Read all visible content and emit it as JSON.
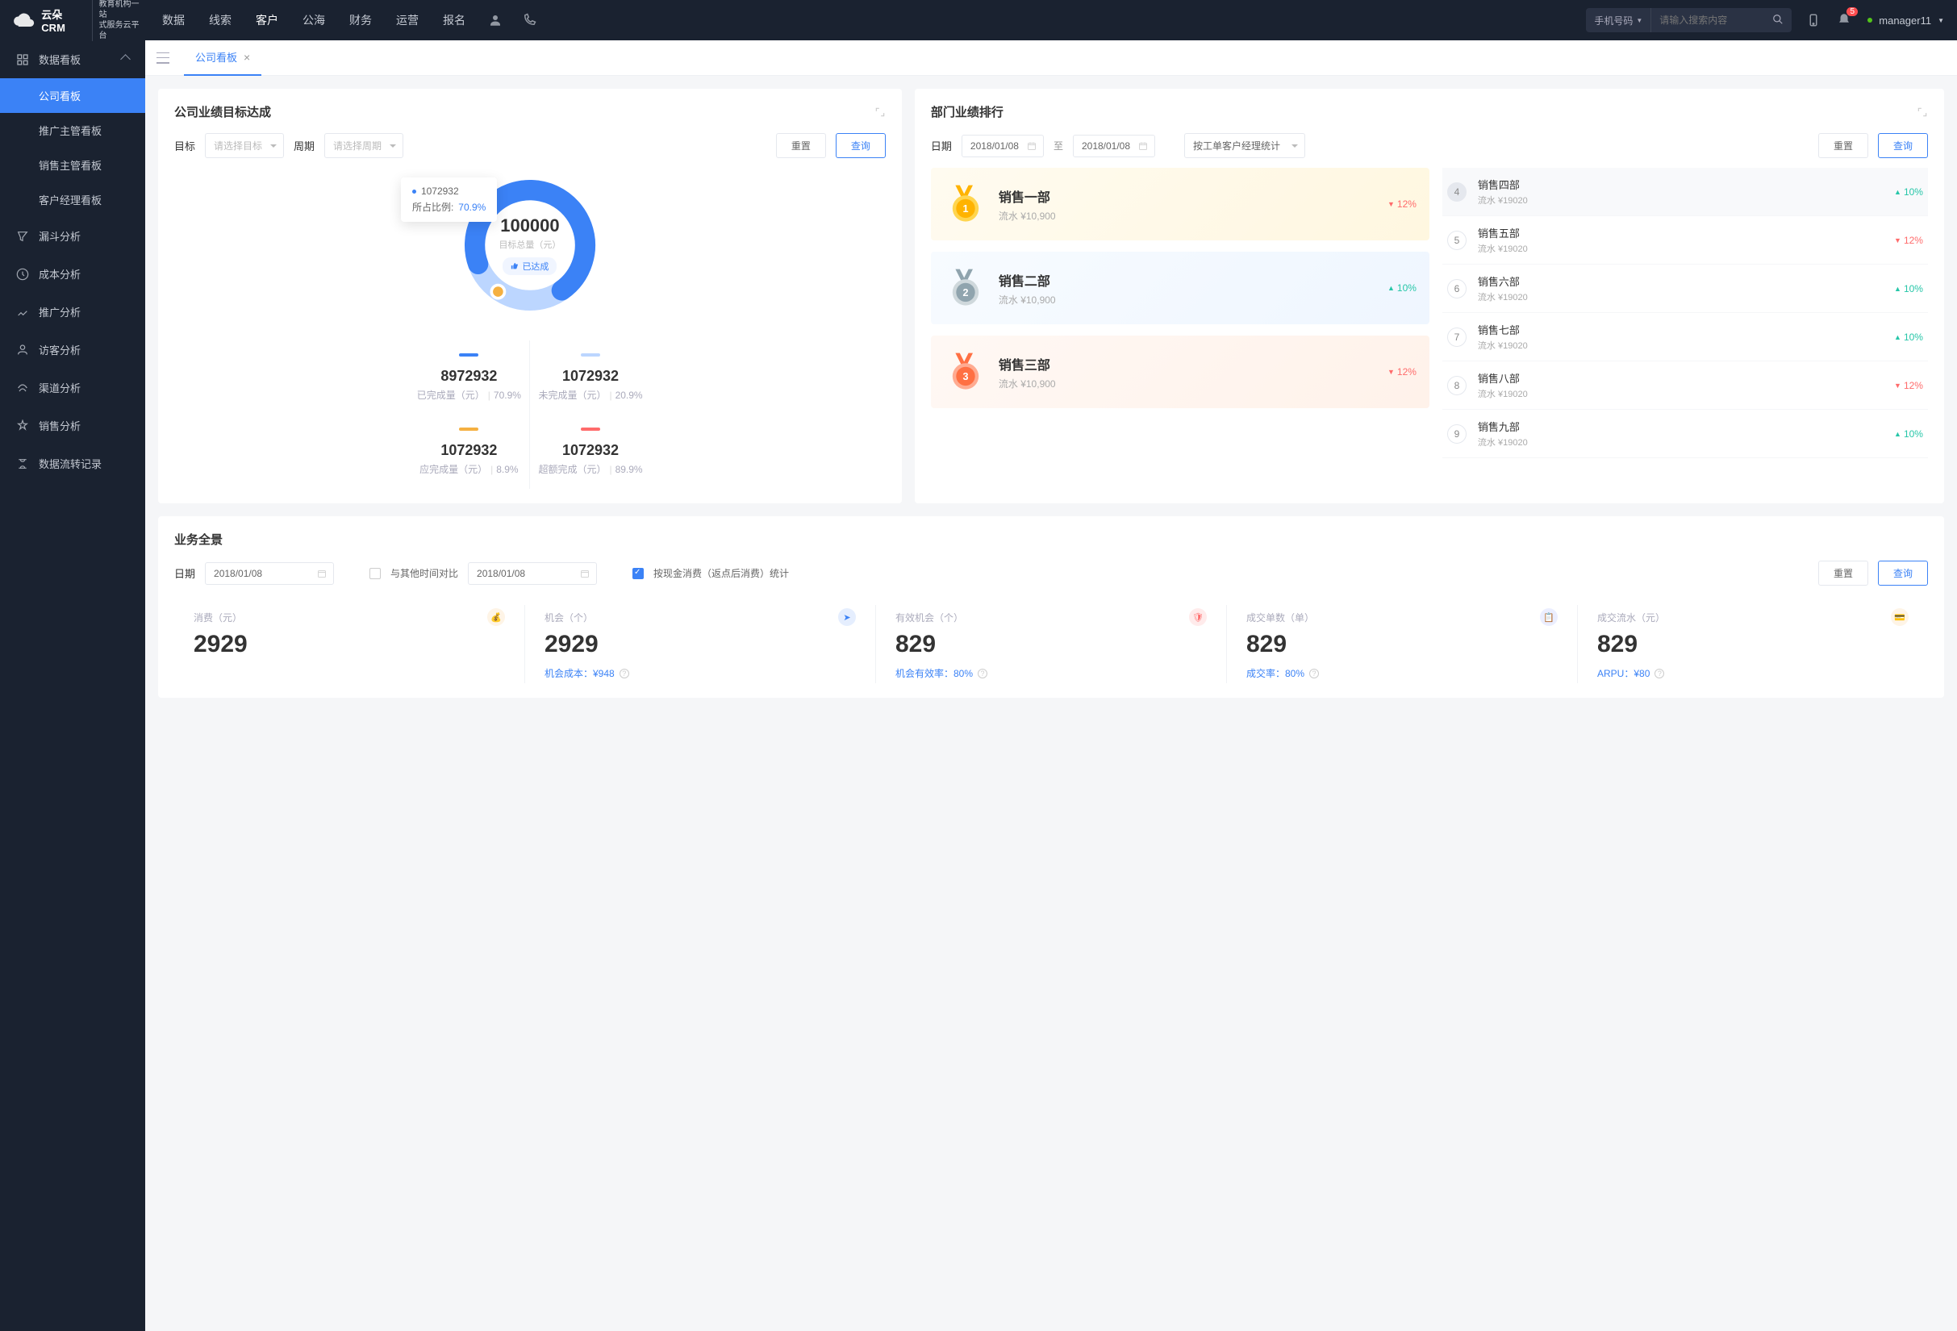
{
  "logo": {
    "brand": "云朵CRM",
    "sub1": "教育机构一站",
    "sub2": "式服务云平台"
  },
  "topnav": {
    "items": [
      "数据",
      "线索",
      "客户",
      "公海",
      "财务",
      "运营",
      "报名"
    ],
    "activeIndex": 2
  },
  "search": {
    "type": "手机号码",
    "placeholder": "请输入搜索内容"
  },
  "notification_count": "5",
  "user": "manager11",
  "sidebar": {
    "group_title": "数据看板",
    "subs": [
      "公司看板",
      "推广主管看板",
      "销售主管看板",
      "客户经理看板"
    ],
    "items": [
      "漏斗分析",
      "成本分析",
      "推广分析",
      "访客分析",
      "渠道分析",
      "销售分析",
      "数据流转记录"
    ]
  },
  "tab": {
    "label": "公司看板"
  },
  "goal_card": {
    "title": "公司业绩目标达成",
    "filters": {
      "target_label": "目标",
      "target_ph": "请选择目标",
      "period_label": "周期",
      "period_ph": "请选择周期"
    },
    "reset": "重置",
    "query": "查询",
    "tooltip": {
      "value": "1072932",
      "ratio_label": "所占比例:",
      "ratio": "70.9%"
    },
    "center": {
      "value": "100000",
      "label": "目标总量（元）",
      "status": "已达成"
    },
    "stats": [
      {
        "bar": "#3b82f6",
        "value": "8972932",
        "label": "已完成量（元）",
        "pct": "70.9%"
      },
      {
        "bar": "#bcd6ff",
        "value": "1072932",
        "label": "未完成量（元）",
        "pct": "20.9%"
      },
      {
        "bar": "#f5b041",
        "value": "1072932",
        "label": "应完成量（元）",
        "pct": "8.9%"
      },
      {
        "bar": "#ff6b6b",
        "value": "1072932",
        "label": "超额完成（元）",
        "pct": "89.9%"
      }
    ]
  },
  "rank_card": {
    "title": "部门业绩排行",
    "filters": {
      "date_label": "日期",
      "date_from": "2018/01/08",
      "date_to_label": "至",
      "date_to": "2018/01/08",
      "stat_by": "按工单客户经理统计"
    },
    "reset": "重置",
    "query": "查询",
    "top3": [
      {
        "name": "销售一部",
        "sub": "流水 ¥10,900",
        "pct": "12%",
        "dir": "up"
      },
      {
        "name": "销售二部",
        "sub": "流水 ¥10,900",
        "pct": "10%",
        "dir": "down"
      },
      {
        "name": "销售三部",
        "sub": "流水 ¥10,900",
        "pct": "12%",
        "dir": "up"
      }
    ],
    "rest": [
      {
        "n": "4",
        "name": "销售四部",
        "sub": "流水 ¥19020",
        "pct": "10%",
        "dir": "down"
      },
      {
        "n": "5",
        "name": "销售五部",
        "sub": "流水 ¥19020",
        "pct": "12%",
        "dir": "up"
      },
      {
        "n": "6",
        "name": "销售六部",
        "sub": "流水 ¥19020",
        "pct": "10%",
        "dir": "down"
      },
      {
        "n": "7",
        "name": "销售七部",
        "sub": "流水 ¥19020",
        "pct": "10%",
        "dir": "down"
      },
      {
        "n": "8",
        "name": "销售八部",
        "sub": "流水 ¥19020",
        "pct": "12%",
        "dir": "up"
      },
      {
        "n": "9",
        "name": "销售九部",
        "sub": "流水 ¥19020",
        "pct": "10%",
        "dir": "down"
      }
    ]
  },
  "overview": {
    "title": "业务全景",
    "date_label": "日期",
    "date1": "2018/01/08",
    "compare_label": "与其他时间对比",
    "date2": "2018/01/08",
    "cash_label": "按现金消费（返点后消费）统计",
    "reset": "重置",
    "query": "查询",
    "kpis": [
      {
        "label": "消费（元）",
        "value": "2929",
        "sub": "",
        "color": "#f5b041"
      },
      {
        "label": "机会（个）",
        "value": "2929",
        "sub_label": "机会成本：",
        "sub_val": "¥948",
        "color": "#3b82f6"
      },
      {
        "label": "有效机会（个）",
        "value": "829",
        "sub_label": "机会有效率：",
        "sub_val": "80%",
        "color": "#ff6b6b"
      },
      {
        "label": "成交单数（单）",
        "value": "829",
        "sub_label": "成交率：",
        "sub_val": "80%",
        "color": "#6c7fff"
      },
      {
        "label": "成交流水（元）",
        "value": "829",
        "sub_label": "ARPU：",
        "sub_val": "¥80",
        "color": "#f5b041"
      }
    ]
  },
  "chart_data": {
    "type": "pie",
    "title": "目标总量（元）",
    "total": 100000,
    "slices": [
      {
        "name": "已完成量",
        "value": 8972932,
        "pct": 70.9,
        "color": "#3b82f6"
      },
      {
        "name": "未完成量",
        "value": 1072932,
        "pct": 20.9,
        "color": "#bcd6ff"
      }
    ],
    "extra": [
      {
        "name": "应完成量",
        "value": 1072932,
        "pct": 8.9
      },
      {
        "name": "超额完成",
        "value": 1072932,
        "pct": 89.9
      }
    ]
  }
}
